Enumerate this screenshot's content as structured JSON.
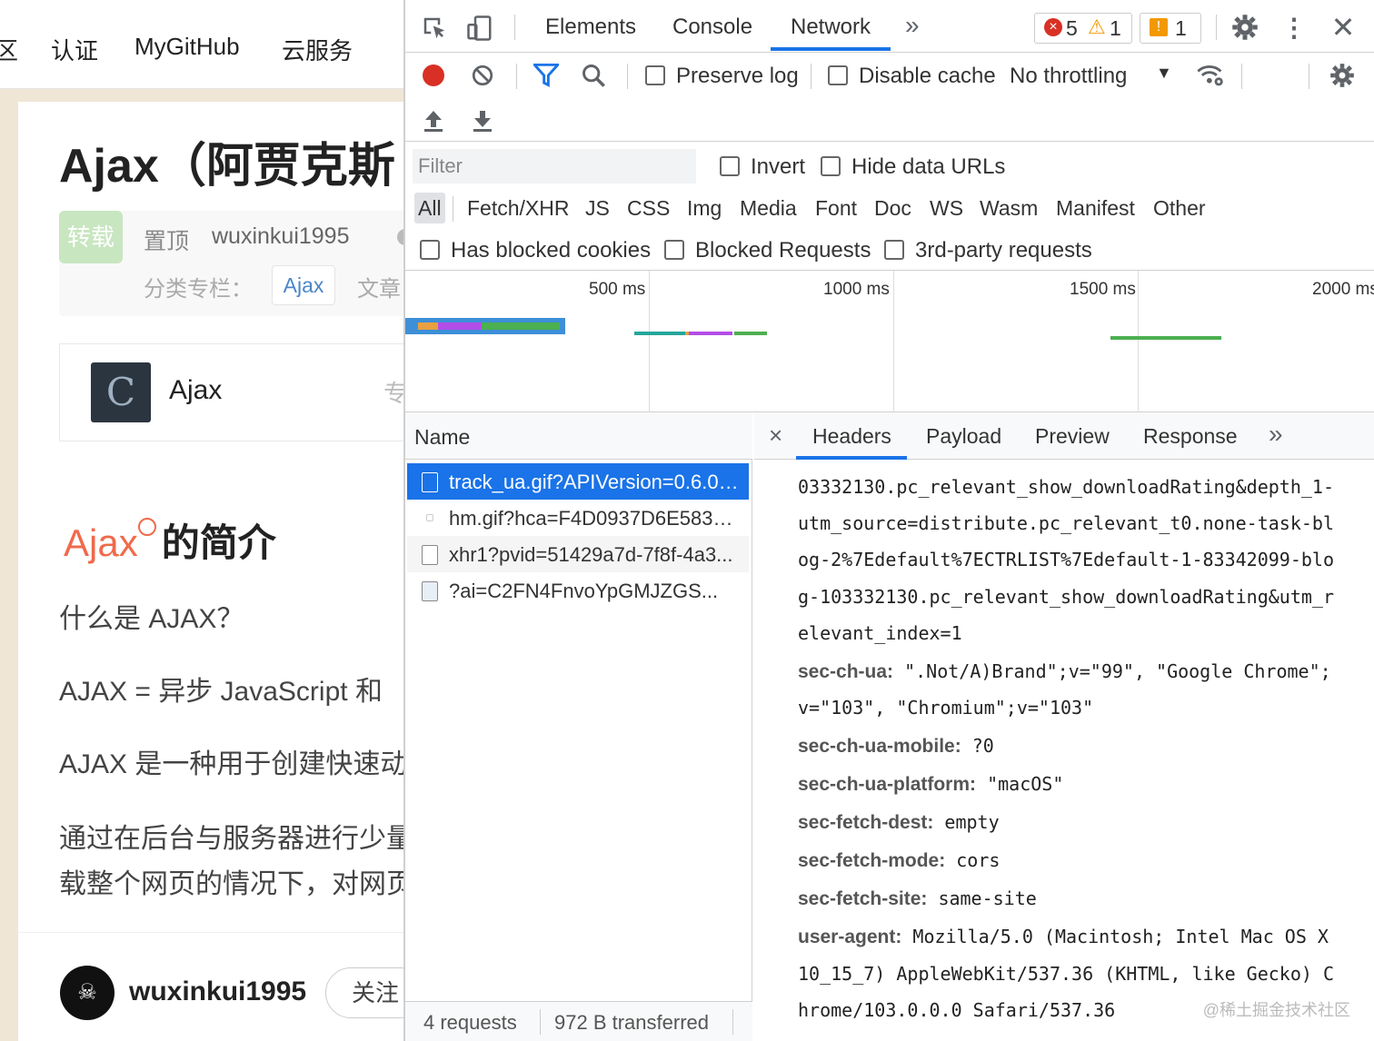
{
  "page": {
    "nav": [
      "区",
      "认证",
      "MyGitHub",
      "云服务"
    ],
    "title": "Ajax（阿贾克斯",
    "badge": "转载",
    "pin": "置顶",
    "author": "wuxinkui1995",
    "category_label": "分类专栏：",
    "category_tag": "Ajax",
    "article_tag": "文章",
    "column_name": "Ajax",
    "column_more": "专",
    "heading_link": "Ajax",
    "heading_rest": "的简介",
    "paragraphs": [
      "什么是 AJAX？",
      "AJAX = 异步 JavaScript 和",
      "AJAX 是一种用于创建快速动",
      "通过在后台与服务器进行少量",
      "载整个网页的情况下，对网页"
    ],
    "author_bottom": "wuxinkui1995",
    "follow": "关注"
  },
  "devtools": {
    "tabs": [
      "Elements",
      "Console",
      "Network"
    ],
    "more_tabs": "»",
    "error_count": "5",
    "warning_count": "1",
    "message_count": "1",
    "toolbar": {
      "preserve_log": "Preserve log",
      "disable_cache": "Disable cache",
      "throttling": "No throttling"
    },
    "filter": {
      "placeholder": "Filter",
      "invert": "Invert",
      "hide_data_urls": "Hide data URLs",
      "types": [
        "All",
        "Fetch/XHR",
        "JS",
        "CSS",
        "Img",
        "Media",
        "Font",
        "Doc",
        "WS",
        "Wasm",
        "Manifest",
        "Other"
      ],
      "has_blocked_cookies": "Has blocked cookies",
      "blocked_requests": "Blocked Requests",
      "third_party": "3rd-party requests"
    },
    "overview": {
      "ticks": [
        "500 ms",
        "1000 ms",
        "1500 ms",
        "2000 ms"
      ],
      "colors": {
        "waiting": "#e8a040",
        "ssl": "#b34de8",
        "download": "#4caf50",
        "queue": "#3d8fd8",
        "dns": "#26a69a"
      }
    },
    "requests": {
      "header": "Name",
      "items": [
        "track_ua.gif?APIVersion=0.6.0&...",
        "hm.gif?hca=F4D0937D6E5835...",
        "xhr1?pvid=51429a7d-7f8f-4a3...",
        "?ai=C2FN4FnvoYpGMJZGS..."
      ],
      "count": "4 requests",
      "transferred": "972 B transferred"
    },
    "detail": {
      "tabs": [
        "Headers",
        "Payload",
        "Preview",
        "Response"
      ],
      "close": "×",
      "more": "»",
      "lines": [
        {
          "name": "",
          "value": "03332130.pc_relevant_show_downloadRating&depth_1-"
        },
        {
          "name": "",
          "value": "utm_source=distribute.pc_relevant_t0.none-task-bl"
        },
        {
          "name": "",
          "value": "og-2%7Edefault%7ECTRLIST%7Edefault-1-83342099-blo"
        },
        {
          "name": "",
          "value": "g-103332130.pc_relevant_show_downloadRating&utm_r"
        },
        {
          "name": "",
          "value": "elevant_index=1"
        },
        {
          "name": "sec-ch-ua:",
          "value": "\".Not/A)Brand\";v=\"99\", \"Google Chrome\";"
        },
        {
          "name": "",
          "value": "v=\"103\", \"Chromium\";v=\"103\""
        },
        {
          "name": "sec-ch-ua-mobile:",
          "value": "?0"
        },
        {
          "name": "sec-ch-ua-platform:",
          "value": "\"macOS\""
        },
        {
          "name": "sec-fetch-dest:",
          "value": "empty"
        },
        {
          "name": "sec-fetch-mode:",
          "value": "cors"
        },
        {
          "name": "sec-fetch-site:",
          "value": "same-site"
        },
        {
          "name": "user-agent:",
          "value": "Mozilla/5.0 (Macintosh; Intel Mac OS X"
        },
        {
          "name": "",
          "value": "10_15_7) AppleWebKit/537.36 (KHTML, like Gecko) C"
        },
        {
          "name": "",
          "value": "hrome/103.0.0.0 Safari/537.36"
        }
      ]
    },
    "watermark": "@稀土掘金技术社区"
  }
}
